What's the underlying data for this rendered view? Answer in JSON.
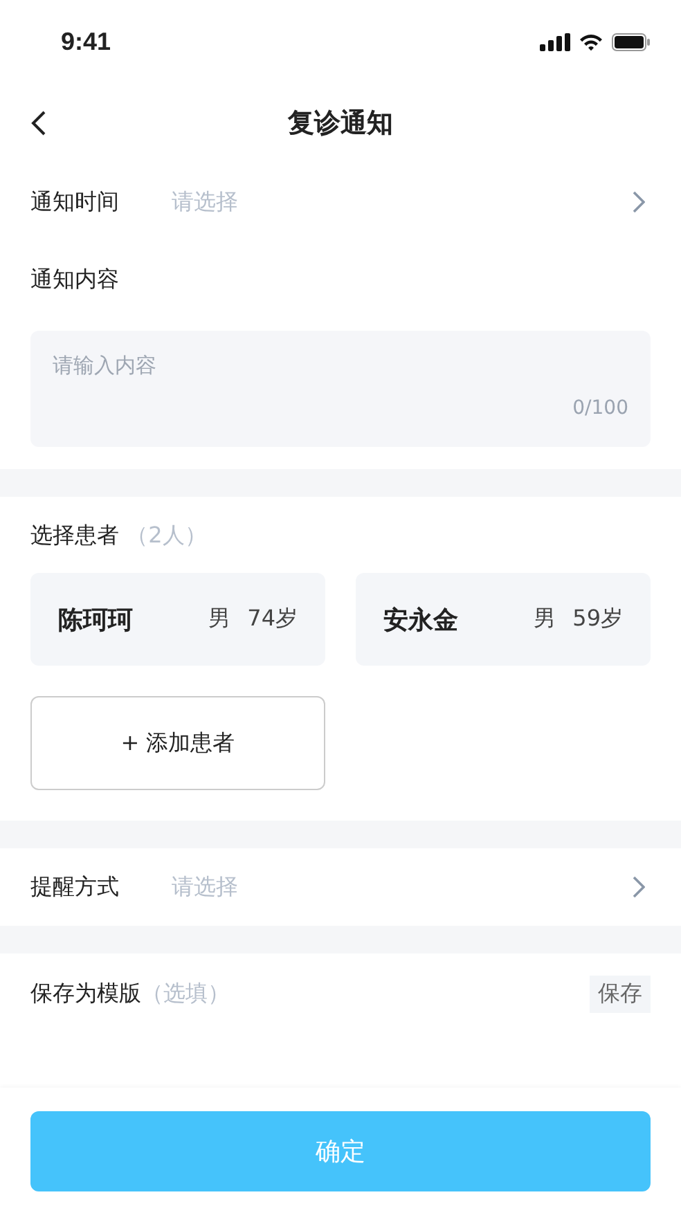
{
  "status_bar": {
    "time": "9:41"
  },
  "nav": {
    "title": "复诊通知"
  },
  "notify_time": {
    "label": "通知时间",
    "placeholder": "请选择"
  },
  "content": {
    "label": "通知内容",
    "placeholder": "请输入内容",
    "counter": "0/100"
  },
  "patients": {
    "label": "选择患者",
    "count": "（2人）",
    "items": [
      {
        "name": "陈珂珂",
        "gender": "男",
        "age": "74岁"
      },
      {
        "name": "安永金",
        "gender": "男",
        "age": "59岁"
      }
    ],
    "add_button": {
      "icon": "+",
      "label": "添加患者"
    }
  },
  "remind": {
    "label": "提醒方式",
    "placeholder": "请选择"
  },
  "template": {
    "label": "保存为模版",
    "hint": "（选填）",
    "save_button": "保存"
  },
  "confirm_button": "确定"
}
